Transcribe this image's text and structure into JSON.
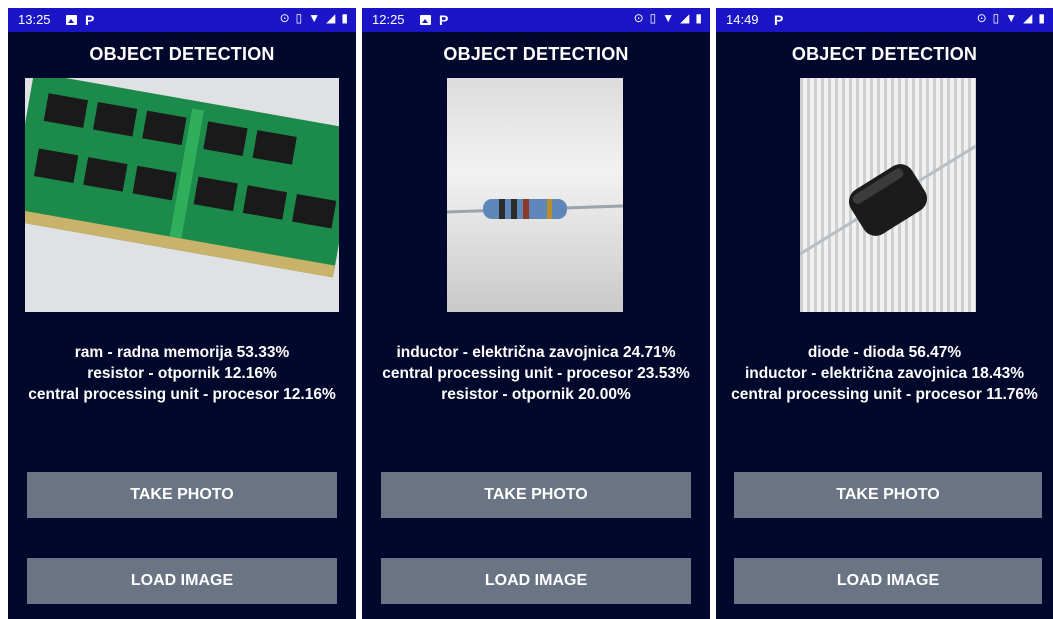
{
  "screens": [
    {
      "status_time": "13:25",
      "status_icons": [
        "photo-icon",
        "parking-icon"
      ],
      "title": "OBJECT DETECTION",
      "image_subject": "ram",
      "results": [
        "ram - radna memorija 53.33%",
        "resistor - otpornik 12.16%",
        "central processing unit - procesor 12.16%"
      ],
      "take_photo_label": "TAKE PHOTO",
      "load_image_label": "LOAD IMAGE"
    },
    {
      "status_time": "12:25",
      "status_icons": [
        "photo-icon",
        "parking-icon"
      ],
      "title": "OBJECT DETECTION",
      "image_subject": "resistor",
      "results": [
        "inductor - električna zavojnica 24.71%",
        "central processing unit - procesor 23.53%",
        "resistor - otpornik 20.00%"
      ],
      "take_photo_label": "TAKE PHOTO",
      "load_image_label": "LOAD IMAGE"
    },
    {
      "status_time": "14:49",
      "status_icons": [
        "parking-icon"
      ],
      "title": "OBJECT DETECTION",
      "image_subject": "diode",
      "results": [
        "diode - dioda 56.47%",
        "inductor - električna zavojnica 18.43%",
        "central processing unit - procesor 11.76%"
      ],
      "take_photo_label": "TAKE PHOTO",
      "load_image_label": "LOAD IMAGE"
    }
  ],
  "colors": {
    "status_bar": "#1a16c8",
    "background": "#02082b",
    "button": "#6a7485",
    "text": "#ffffff"
  }
}
